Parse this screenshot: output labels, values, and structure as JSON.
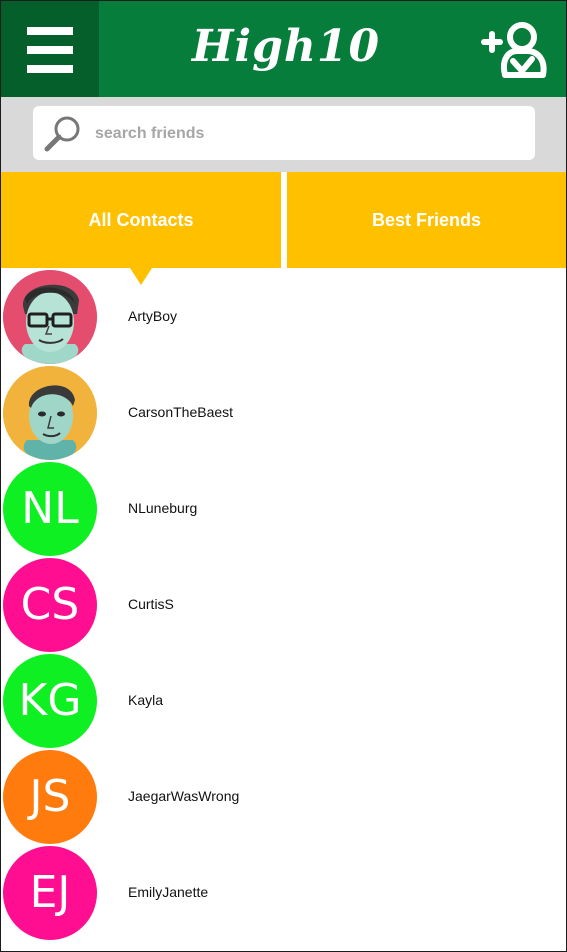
{
  "header": {
    "app_title": "High10",
    "colors": {
      "header": "#067d3a",
      "menu": "#045f2b",
      "accent": "#ffc000"
    }
  },
  "search": {
    "placeholder": "search friends",
    "value": ""
  },
  "tabs": [
    {
      "label": "All Contacts",
      "selected": true
    },
    {
      "label": "Best Friends",
      "selected": false
    }
  ],
  "contacts": [
    {
      "name": "ArtyBoy",
      "avatar_type": "photo",
      "avatar_bg": "#e44d6e"
    },
    {
      "name": "CarsonTheBaest",
      "avatar_type": "photo",
      "avatar_bg": "#f2b33d"
    },
    {
      "name": "NLuneburg",
      "initials": "NL",
      "avatar_bg": "#0ff022"
    },
    {
      "name": "CurtisS",
      "initials": "CS",
      "avatar_bg": "#ff0e91"
    },
    {
      "name": "Kayla",
      "initials": "KG",
      "avatar_bg": "#0ff022"
    },
    {
      "name": "JaegarWasWrong",
      "initials": "JS",
      "avatar_bg": "#ff7b0e"
    },
    {
      "name": "EmilyJanette",
      "initials": "EJ",
      "avatar_bg": "#ff0e91"
    }
  ]
}
